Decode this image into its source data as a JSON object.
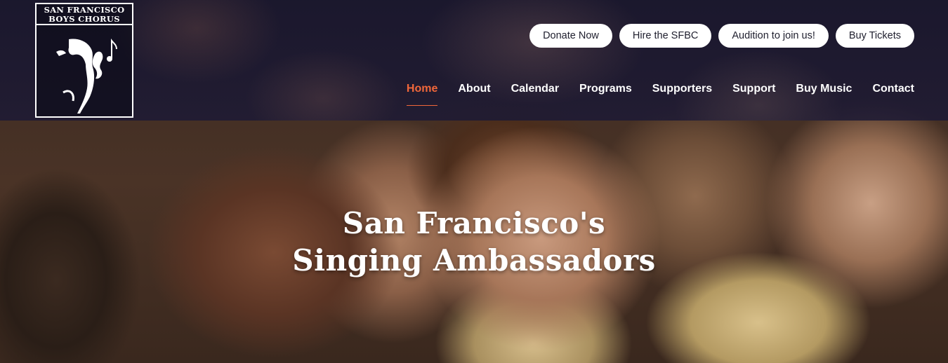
{
  "logo": {
    "line1": "SAN FRANCISCO",
    "line2": "BOYS CHORUS"
  },
  "header": {
    "buttons": [
      {
        "label": "Donate Now",
        "icon": null
      },
      {
        "label": "Hire the SFBC",
        "icon": null
      },
      {
        "label": "Audition to join us!",
        "icon": null
      },
      {
        "label": "Buy Tickets",
        "icon": null
      }
    ],
    "nav": [
      {
        "label": "Home",
        "active": true
      },
      {
        "label": "About",
        "active": false
      },
      {
        "label": "Calendar",
        "active": false
      },
      {
        "label": "Programs",
        "active": false
      },
      {
        "label": "Supporters",
        "active": false
      },
      {
        "label": "Support",
        "active": false
      },
      {
        "label": "Buy Music",
        "active": false
      },
      {
        "label": "Contact",
        "active": false
      }
    ]
  },
  "hero": {
    "headline_line1": "San Francisco's",
    "headline_line2": "Singing Ambassadors"
  },
  "colors": {
    "accent": "#f0673a",
    "header_bg": "#1c1934",
    "button_bg": "#ffffff"
  }
}
